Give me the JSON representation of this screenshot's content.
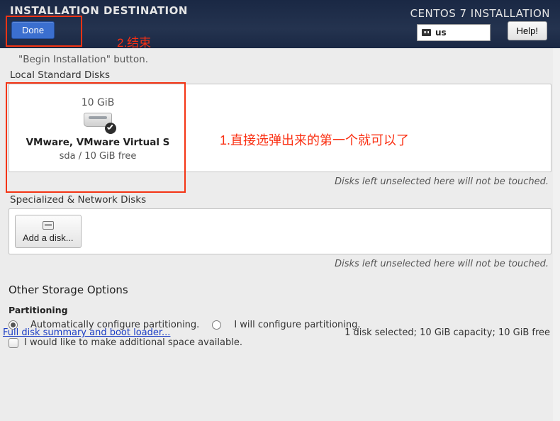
{
  "header": {
    "title": "INSTALLATION DESTINATION",
    "product": "CENTOS 7 INSTALLATION",
    "done": "Done",
    "help": "Help!",
    "lang": "us"
  },
  "hint": "\"Begin Installation\" button.",
  "sections": {
    "local_disks": "Local Standard Disks",
    "network_disks": "Specialized & Network Disks",
    "other_storage": "Other Storage Options",
    "partitioning": "Partitioning"
  },
  "disk": {
    "size": "10 GiB",
    "name": "VMware, VMware Virtual S",
    "subinfo": "sda    /    10 GiB free"
  },
  "untouched_note": "Disks left unselected here will not be touched.",
  "add_disk": "Add a disk...",
  "partitioning": {
    "auto": "Automatically configure partitioning.",
    "manual": "I will configure partitioning.",
    "make_space": "I would like to make additional space available."
  },
  "bottom": {
    "link": "Full disk summary and boot loader...",
    "status": "1 disk selected; 10 GiB capacity; 10 GiB free"
  },
  "annotations": {
    "a1": "1.直接选弹出来的第一个就可以了",
    "a2": "2.结束"
  }
}
